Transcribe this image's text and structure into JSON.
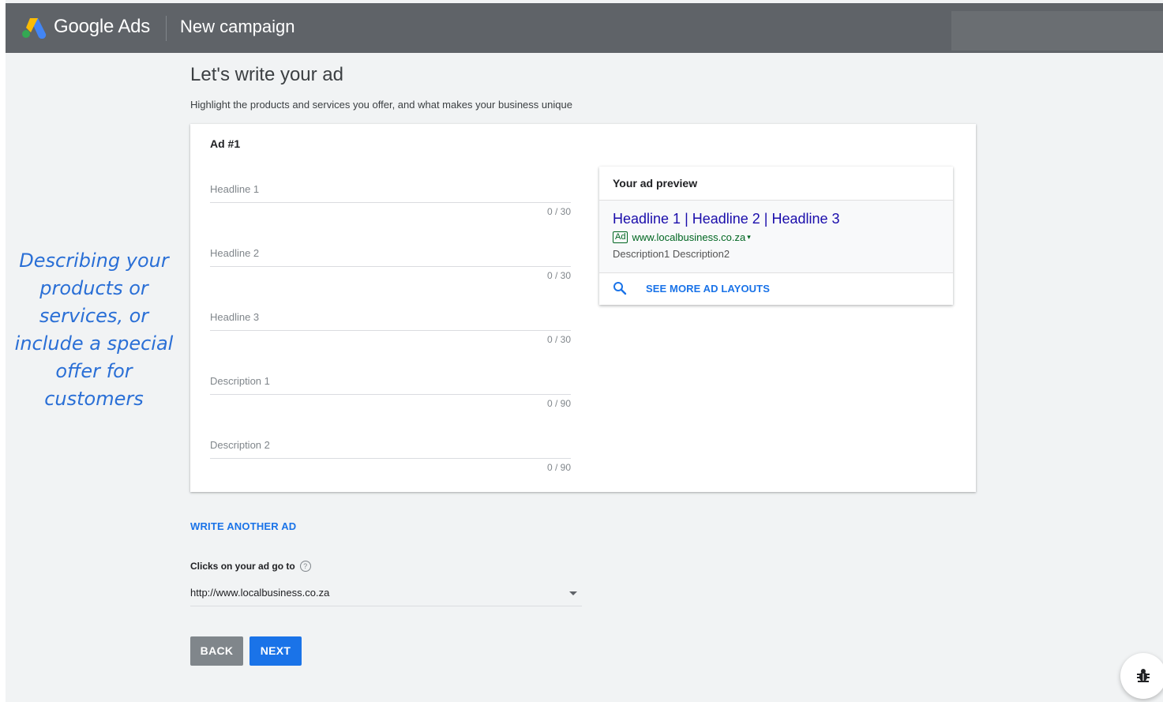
{
  "header": {
    "brand": "Google Ads",
    "title": "New campaign"
  },
  "page": {
    "heading": "Let's write your ad",
    "subheading": "Highlight the products and services you offer, and what makes your business unique"
  },
  "ad": {
    "label": "Ad #1",
    "fields": [
      {
        "label": "Headline 1",
        "counter": "0 / 30"
      },
      {
        "label": "Headline 2",
        "counter": "0 / 30"
      },
      {
        "label": "Headline 3",
        "counter": "0 / 30"
      },
      {
        "label": "Description 1",
        "counter": "0 / 90"
      },
      {
        "label": "Description 2",
        "counter": "0 / 90"
      }
    ]
  },
  "preview": {
    "title": "Your ad preview",
    "headline": "Headline 1 | Headline 2 | Headline 3",
    "badge": "Ad",
    "url": "www.localbusiness.co.za",
    "caret": "▾",
    "description": "Description1 Description2",
    "more_layouts": "SEE MORE AD LAYOUTS",
    "link_color": "#1a0dab",
    "url_color": "#006621"
  },
  "write_another": "WRITE ANOTHER AD",
  "final_url": {
    "label": "Clicks on your ad go to",
    "help": "?",
    "value": "http://www.localbusiness.co.za"
  },
  "buttons": {
    "back": "BACK",
    "next": "NEXT"
  },
  "annotation": {
    "lines": [
      "Describing your",
      "products or",
      "services, or",
      "include a special",
      "offer for",
      "customers"
    ],
    "color": "#2a6fd6"
  },
  "icons": {
    "logo": "google-ads-logo",
    "search": "search-icon",
    "help": "help-icon",
    "dropdown": "dropdown-arrow-icon",
    "bug": "bug-icon"
  },
  "colors": {
    "header_bg": "#5f6368",
    "accent": "#1a73e8",
    "back_button": "#80868b"
  }
}
